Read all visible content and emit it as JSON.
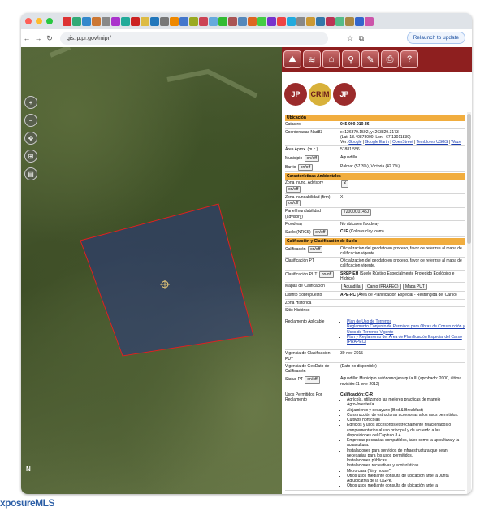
{
  "browser": {
    "url": "gis.jp.pr.gov/mipr/",
    "relaunch_label": "Relaunch to update",
    "tab_colors": [
      "#d33",
      "#3a7",
      "#38c",
      "#c73",
      "#888",
      "#a3c",
      "#2a9",
      "#c22",
      "#db4",
      "#27b",
      "#777",
      "#e80",
      "#47c",
      "#9a2",
      "#c45",
      "#6ad",
      "#3b3",
      "#a55",
      "#58b",
      "#d62",
      "#4c4",
      "#73c",
      "#e44",
      "#2ad",
      "#888",
      "#c93",
      "#37a",
      "#b35",
      "#5b8",
      "#a84",
      "#36c",
      "#c5a"
    ]
  },
  "map": {
    "north_label": "N",
    "tool_icons": [
      "zoom-in-icon",
      "zoom-out-icon",
      "pan-icon",
      "measure-icon",
      "layers-icon"
    ]
  },
  "toolbar": {
    "icons": [
      "map-icon",
      "layers-icon",
      "search-parcel-icon",
      "magnify-icon",
      "draw-icon",
      "print-icon",
      "help-icon"
    ]
  },
  "logos": [
    {
      "text": "JP"
    },
    {
      "text": "CRIM"
    },
    {
      "text": "JP"
    }
  ],
  "info": {
    "ubicacion_title": "Ubicación",
    "catastro_label": "Catastro",
    "catastro": "045-000-010-36",
    "coord_label": "Coordenadas Nad83",
    "coord1": "x: 126379.1592, y: 263829.3173",
    "coord2": "(Lat: 18.40878000, Lon: -67.13011839)",
    "ver_label": "Ver:",
    "links": [
      "Google",
      "Google Earth",
      "OpenStreet",
      "Temblores USGS",
      "Waze"
    ],
    "area_label": "Área Aprox. (m.c.)",
    "area": "51881.556",
    "municipio_label": "Municipio",
    "municipio": "Aguadilla",
    "barrio_label": "Barrio",
    "barrio": "Palmar (57.3%), Victoria (42.7%)",
    "onoff": "on/off",
    "carac_title": "Características Ambientales",
    "zona_inund_label": "Zona Inund. Advisory",
    "zona_inund": "X",
    "zona_inund_firm_label": "Zona Inundabilidad (firm)",
    "zona_inund_firm": "X",
    "panel_label": "Panel Inundabilidad (advisory)",
    "panel": "72000C0145J",
    "floodway_label": "Floodway",
    "floodway": "No ubica en floodway",
    "suelo_label": "Suelo (NRCS)",
    "suelo_code": "C1E",
    "suelo": "(Colinas clay loam)",
    "calif_title": "Calificación y Clasificación de Suelo",
    "calif_label": "Calificación",
    "calif": "Oficializacion del geodato en proceso, favor de referirse al mapa de calificacion vigente.",
    "clasif_label": "Clasificación PT",
    "clasif": "Oficializacion del geodato en proceso, favor de referirse al mapa de calificacion vigente.",
    "clasif_put_label": "Clasificación PUT",
    "clasif_put_code": "SREP-EH",
    "clasif_put": "(Suelo Rústico Especialmente Protegido Ecológico e Hídrico)",
    "mapas_label": "Mapas de Calificación",
    "mapas_btns": [
      "Aguadilla",
      "Carso (PRAPEC)",
      "Mapa PUT"
    ],
    "distrito_label": "Distrito Sobrepuesto",
    "distrito_code": "APE-RC",
    "distrito": "(Área de Planificación Especial - Restringida del Carso)",
    "zona_hist_label": "Zona Histórica",
    "sitio_hist_label": "Sitio Histórico",
    "reglamento_label": "Reglamento Aplicable",
    "reglamentos": [
      "Plan de Uso de Terrenos",
      "Reglamento Conjunto de Permisos para Obras de Construcción y Usos de Terrenos Vigente",
      "Plan y Reglamento del Área de Planificación Especial del Carso (PRAPEC)"
    ],
    "vigencia_label": "Vigencia de Clasificación PUT",
    "vigencia": "30-nov-2015",
    "vigencia_geo_label": "Vigencia de GeoDato de Calificación",
    "vigencia_geo": "(Dato no disponible)",
    "status_label": "Status PT",
    "status": "Aguadilla: Municipio autónomo jerarquía III (aprobado: 2000, última revisión:11-ene-2012)",
    "usos_label": "Usos Permitidos Por Reglamento",
    "usos_title": "Calificación: C-R",
    "usos": [
      "Agrícola, utilizando las mejores prácticas de manejo",
      "Agro-forestería",
      "Alojamiento y desayuno (Bed & Breakfast)",
      "Construcción de estructuras accesorias a los usos permitidos.",
      "Cultivos hortícolas",
      "Edificios y usos accesorios estrechamente relacionados o complementarios al uso principal y de acuerdo a las disposiciones del Capítulo 8.4.",
      "Empresas pecuarias compatibles, tales como la apicultura y la acuacultura.",
      "Instalaciones para servicios de infraestructura que sean necesarias para los usos permitidos.",
      "Instalaciones públicas",
      "Instalaciones recreativas y ecoturísticas",
      "Micro casa (\"tiny house\")",
      "Otros usos mediante consulta de ubicación ante la Junta Adjudicativa de la OGPe.",
      "Otros usos mediante consulta de ubicación ante la"
    ]
  },
  "footer": {
    "brand": "xposureMLS"
  }
}
